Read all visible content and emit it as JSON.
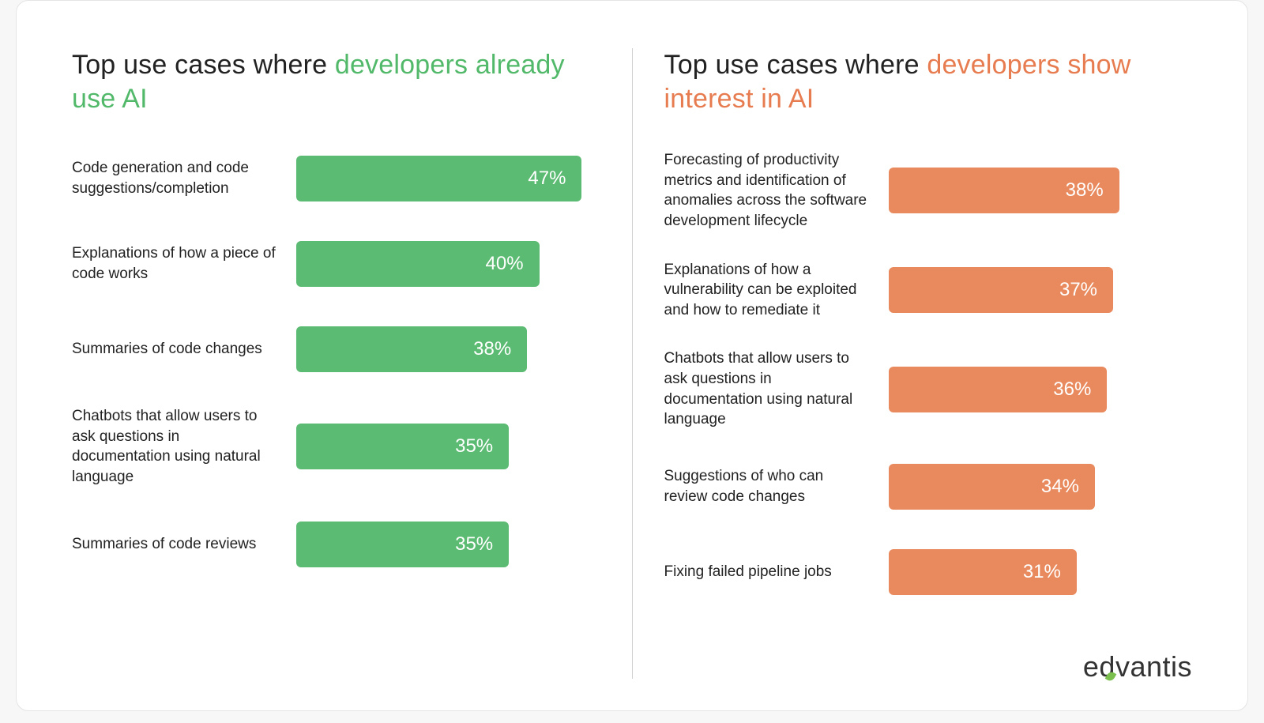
{
  "chart_data": [
    {
      "type": "bar",
      "orientation": "horizontal",
      "title_pre": "Top use cases where ",
      "title_accent": "developers already use AI",
      "accent_color": "#52b96a",
      "bar_color": "#5cbb73",
      "xlim": [
        0,
        50
      ],
      "categories": [
        "Code generation and code suggestions/completion",
        "Explanations of how a piece of code works",
        "Summaries of code changes",
        "Chatbots that allow users to ask questions in documentation using natural language",
        "Summaries of code reviews"
      ],
      "values": [
        47,
        40,
        38,
        35,
        35
      ],
      "value_suffix": "%"
    },
    {
      "type": "bar",
      "orientation": "horizontal",
      "title_pre": "Top use cases where ",
      "title_accent": "developers show interest in AI",
      "accent_color": "#e77c50",
      "bar_color": "#e98a5e",
      "xlim": [
        0,
        50
      ],
      "categories": [
        "Forecasting of productivity metrics and identification of anomalies across the software development lifecycle",
        "Explanations of how a vulnerability can be exploited and how to remediate it",
        "Chatbots that allow users to ask questions in documentation using natural language",
        "Suggestions of who can review code changes",
        "Fixing failed pipeline jobs"
      ],
      "values": [
        38,
        37,
        36,
        34,
        31
      ],
      "value_suffix": "%"
    }
  ],
  "brand": {
    "pre": "e",
    "post": "dvantis"
  }
}
